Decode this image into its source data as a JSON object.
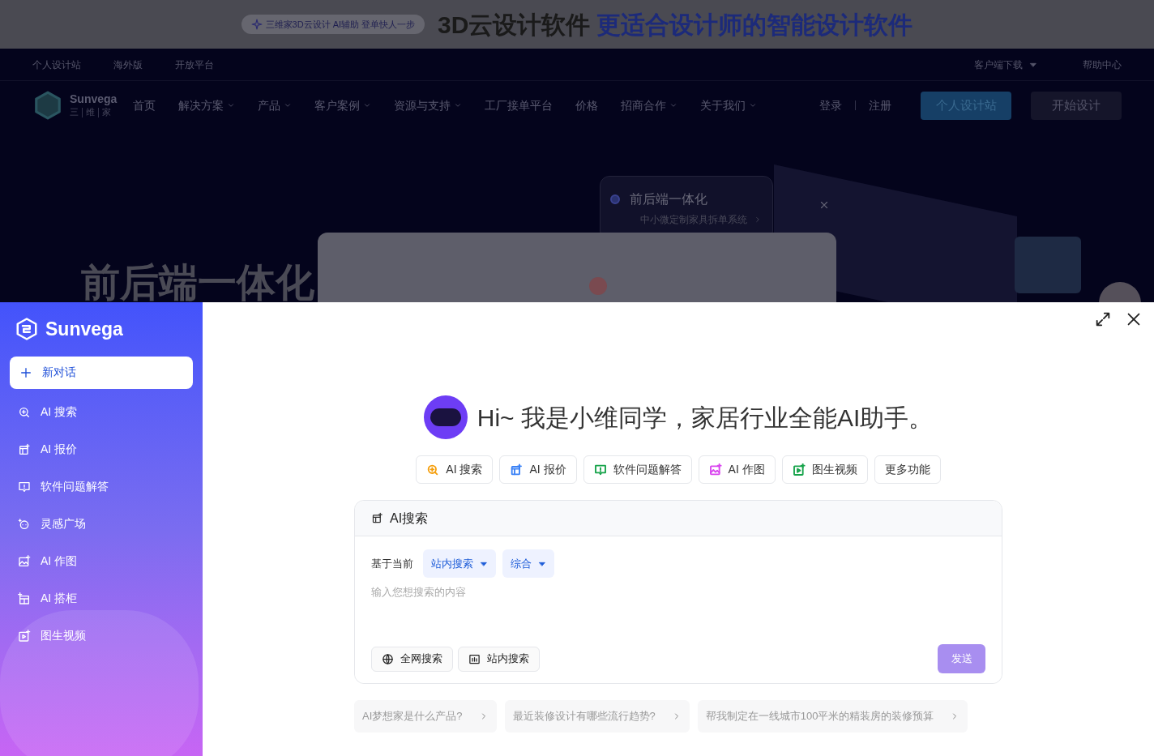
{
  "banner": {
    "pill": "三维家3D云设计 AI辅助 登单快人一步",
    "headline": "3D云设计软件",
    "headline_accent": "更适合设计师的智能设计软件"
  },
  "top_links": {
    "left": [
      "个人设计站",
      "海外版",
      "开放平台"
    ],
    "right": [
      {
        "label": "客户端下载",
        "has_dropdown": true
      },
      {
        "label": "帮助中心",
        "has_dropdown": false
      }
    ]
  },
  "nav": {
    "logo": {
      "name": "Sunvega",
      "sub": [
        "三",
        "维",
        "家"
      ]
    },
    "items": [
      {
        "label": "首页",
        "has_dropdown": false
      },
      {
        "label": "解决方案",
        "has_dropdown": true
      },
      {
        "label": "产品",
        "has_dropdown": true
      },
      {
        "label": "客户案例",
        "has_dropdown": true
      },
      {
        "label": "资源与支持",
        "has_dropdown": true
      },
      {
        "label": "工厂接单平台",
        "has_dropdown": false
      },
      {
        "label": "价格",
        "has_dropdown": false
      },
      {
        "label": "招商合作",
        "has_dropdown": true
      },
      {
        "label": "关于我们",
        "has_dropdown": true
      }
    ],
    "login": "登录",
    "register": "注册",
    "primary_button": "个人设计站",
    "secondary_button": "开始设计"
  },
  "hero": {
    "title": "前后端一体化",
    "feature_card": {
      "title": "前后端一体化",
      "subtitle": "中小微定制家具拆单系统"
    }
  },
  "assistant": {
    "sidebar": {
      "brand": "Sunvega",
      "new_chat": "新对话",
      "items": [
        {
          "label": "AI 搜索",
          "kind": "search",
          "selected": false
        },
        {
          "label": "AI 报价",
          "kind": "quote",
          "selected": false
        },
        {
          "label": "软件问题解答",
          "kind": "chat",
          "selected": false
        },
        {
          "label": "灵感广场",
          "kind": "bulb",
          "selected": false
        },
        {
          "label": "AI 作图",
          "kind": "image",
          "selected": false
        },
        {
          "label": "AI 搭柜",
          "kind": "cabinet",
          "selected": false
        },
        {
          "label": "图生视频",
          "kind": "video",
          "selected": false
        }
      ]
    },
    "greeting": "Hi~ 我是小维同学，家居行业全能AI助手。",
    "chips": [
      {
        "label": "AI 搜索",
        "kind": "search",
        "color": "#f59e0b"
      },
      {
        "label": "AI 报价",
        "kind": "quote",
        "color": "#3b82f6"
      },
      {
        "label": "软件问题解答",
        "kind": "chat",
        "color": "#16a34a"
      },
      {
        "label": "AI 作图",
        "kind": "image",
        "color": "#d946ef"
      },
      {
        "label": "图生视频",
        "kind": "video",
        "color": "#16a34a"
      },
      {
        "label": "更多功能",
        "kind": "more"
      }
    ],
    "search_card": {
      "title": "AI搜索",
      "scope_label": "基于当前",
      "dropdowns": [
        "站内搜索",
        "综合"
      ],
      "placeholder": "输入您想搜索的内容",
      "tools": [
        {
          "label": "全网搜索",
          "kind": "globe"
        },
        {
          "label": "站内搜索",
          "kind": "site"
        }
      ],
      "send_button": {
        "label": "发送",
        "disabled": true
      }
    },
    "suggestions": [
      "AI梦想家是什么产品?",
      "最近装修设计有哪些流行趋势?",
      "帮我制定在一线城市100平米的精装房的装修预算"
    ]
  }
}
